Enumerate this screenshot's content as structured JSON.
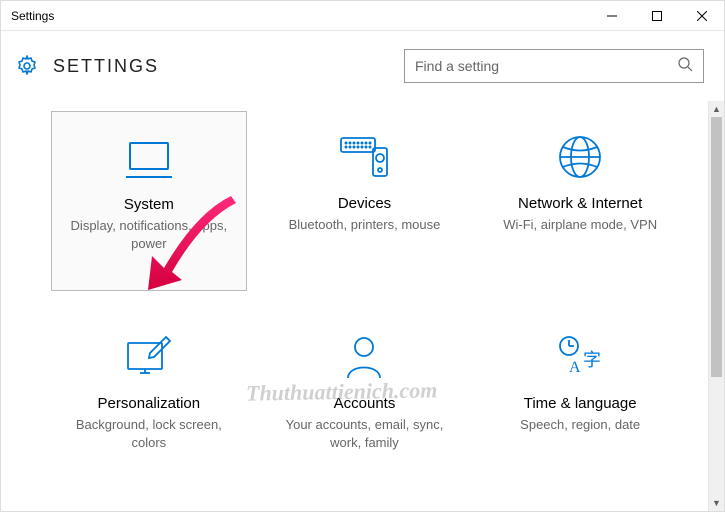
{
  "window": {
    "title": "Settings"
  },
  "header": {
    "title": "SETTINGS"
  },
  "search": {
    "placeholder": "Find a setting"
  },
  "tiles": [
    {
      "title": "System",
      "sub": "Display, notifications, apps, power"
    },
    {
      "title": "Devices",
      "sub": "Bluetooth, printers, mouse"
    },
    {
      "title": "Network & Internet",
      "sub": "Wi-Fi, airplane mode, VPN"
    },
    {
      "title": "Personalization",
      "sub": "Background, lock screen, colors"
    },
    {
      "title": "Accounts",
      "sub": "Your accounts, email, sync, work, family"
    },
    {
      "title": "Time & language",
      "sub": "Speech, region, date"
    }
  ],
  "watermark": "Thuthuattienich.com"
}
